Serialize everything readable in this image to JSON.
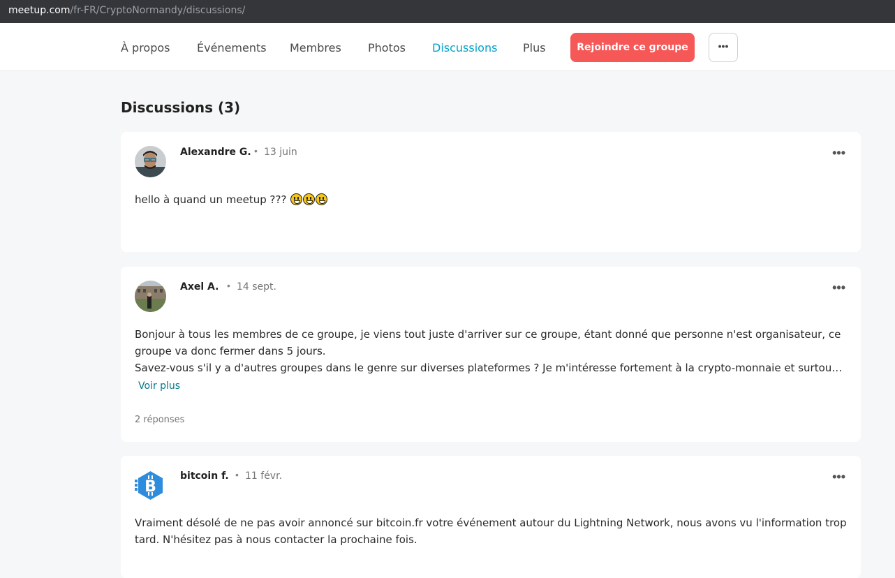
{
  "browser": {
    "url_host": "meetup.com",
    "url_path": "/fr-FR/CryptoNormandy/discussions/"
  },
  "nav": {
    "items": [
      {
        "label": "À propos",
        "active": false
      },
      {
        "label": "Événements",
        "active": false
      },
      {
        "label": "Membres",
        "active": false
      },
      {
        "label": "Photos",
        "active": false
      },
      {
        "label": "Discussions",
        "active": true
      },
      {
        "label": "Plus",
        "active": false
      }
    ],
    "join_label": "Rejoindre ce groupe",
    "more_label": "•••"
  },
  "page": {
    "title": "Discussions (3)"
  },
  "discussions": [
    {
      "author": "Alexandre G.",
      "separator": "•",
      "date": "13 juin",
      "menu": "•••",
      "text": "hello à quand un meetup ???",
      "emoji_icons": [
        "grinning-face-icon",
        "grinning-face-icon",
        "grinning-face-icon"
      ]
    },
    {
      "author": "Axel A.",
      "separator": "•",
      "date": "14 sept.",
      "menu": "•••",
      "text_lines": [
        "Bonjour à tous les membres de ce groupe, je viens tout juste d'arriver sur ce groupe, étant donné que personne n'est organisateur, ce groupe va donc fermer dans 5 jours.",
        "Savez-vous s'il y a d'autres groupes dans le genre sur diverses plateformes ? Je m'intéresse fortement à la crypto-monnaie et surtout..."
      ],
      "see_more": "Voir plus",
      "replies": "2 réponses"
    },
    {
      "author": "bitcoin f.",
      "separator": "•",
      "date": "11 févr.",
      "menu": "•••",
      "text": "Vraiment désolé de ne pas avoir annoncé sur bitcoin.fr votre événement autour du Lightning Network, nous avons vu l'information trop tard. N'hésitez pas à nous contacter la prochaine fois."
    }
  ],
  "colors": {
    "accent": "#00a2c7",
    "join_button": "#f65858",
    "link": "#00798a",
    "bitcoin_logo": "#2d8cde"
  }
}
